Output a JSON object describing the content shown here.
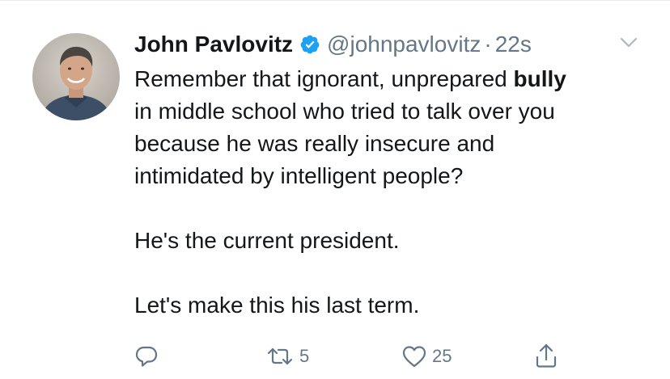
{
  "tweet": {
    "author_name": "John Pavlovitz",
    "handle": "@johnpavlovitz",
    "separator": "·",
    "time": "22s",
    "body": {
      "line1_pre": "Remember that ignorant, unprepared ",
      "line1_bold": "bully",
      "line2": "in middle school who tried to talk over you",
      "line3": "because he was really insecure and",
      "line4": "intimidated by intelligent people?",
      "para2": "He's the current president.",
      "para3": "Let's make this his last term."
    },
    "actions": {
      "retweet_count": "5",
      "like_count": "25"
    }
  },
  "colors": {
    "text": "#14171a",
    "secondary": "#657786",
    "verified": "#1da1f2",
    "divider": "#e6ecf0"
  },
  "icons": {
    "verified": "verified-badge-icon",
    "chevron": "chevron-down-icon",
    "reply": "reply-icon",
    "retweet": "retweet-icon",
    "like": "heart-icon",
    "share": "share-icon"
  }
}
